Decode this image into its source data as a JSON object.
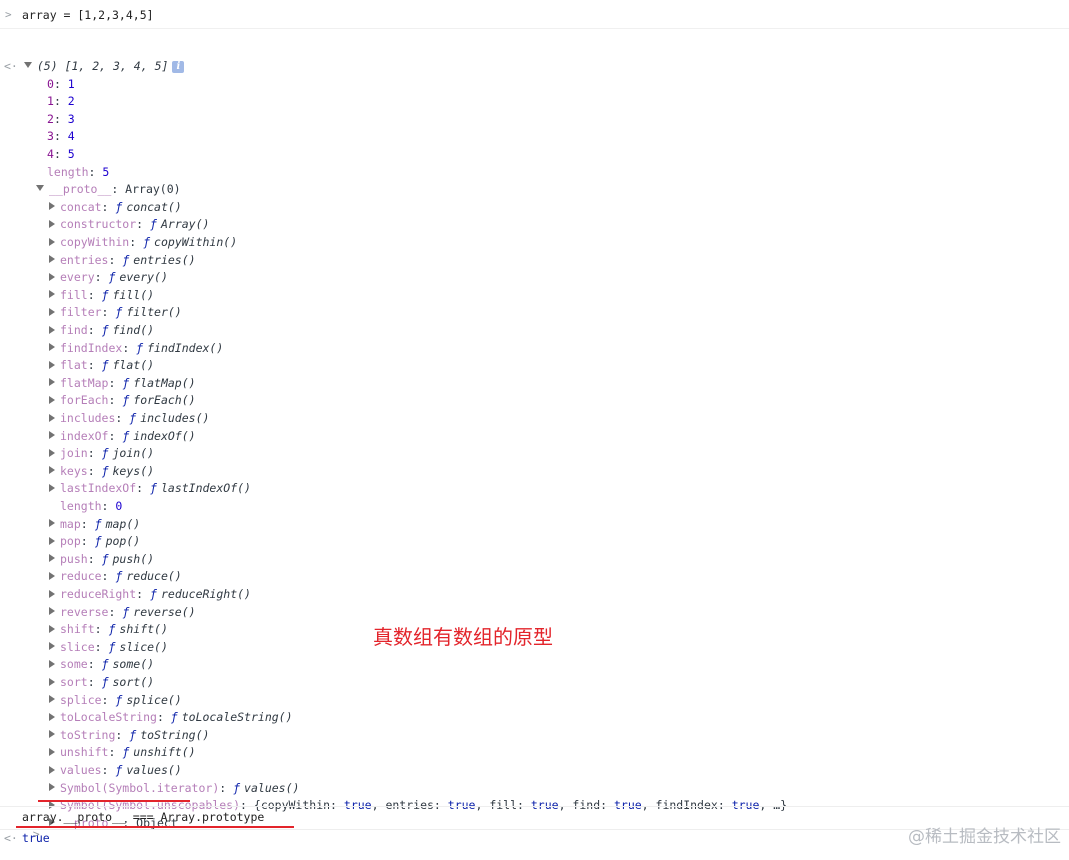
{
  "first_command": {
    "prompt_glyph": ">",
    "text": "array = [1,2,3,4,5]"
  },
  "result": {
    "out_glyph": "<·",
    "summary_count": "(5)",
    "summary_values": "[1, 2, 3, 4, 5]",
    "info_badge": "i",
    "elements": [
      {
        "key": "0",
        "value": "1"
      },
      {
        "key": "1",
        "value": "2"
      },
      {
        "key": "2",
        "value": "3"
      },
      {
        "key": "3",
        "value": "4"
      },
      {
        "key": "4",
        "value": "5"
      }
    ],
    "length_key": "length",
    "length_value": "5",
    "proto_key": "__proto__",
    "proto_value": "Array(0)",
    "proto_methods": [
      {
        "key": "concat",
        "fn": "concat()"
      },
      {
        "key": "constructor",
        "fn": "Array()"
      },
      {
        "key": "copyWithin",
        "fn": "copyWithin()"
      },
      {
        "key": "entries",
        "fn": "entries()"
      },
      {
        "key": "every",
        "fn": "every()"
      },
      {
        "key": "fill",
        "fn": "fill()"
      },
      {
        "key": "filter",
        "fn": "filter()"
      },
      {
        "key": "find",
        "fn": "find()"
      },
      {
        "key": "findIndex",
        "fn": "findIndex()"
      },
      {
        "key": "flat",
        "fn": "flat()"
      },
      {
        "key": "flatMap",
        "fn": "flatMap()"
      },
      {
        "key": "forEach",
        "fn": "forEach()"
      },
      {
        "key": "includes",
        "fn": "includes()"
      },
      {
        "key": "indexOf",
        "fn": "indexOf()"
      },
      {
        "key": "join",
        "fn": "join()"
      },
      {
        "key": "keys",
        "fn": "keys()"
      },
      {
        "key": "lastIndexOf",
        "fn": "lastIndexOf()"
      }
    ],
    "proto_length_key": "length",
    "proto_length_value": "0",
    "proto_methods_2": [
      {
        "key": "map",
        "fn": "map()"
      },
      {
        "key": "pop",
        "fn": "pop()"
      },
      {
        "key": "push",
        "fn": "push()"
      },
      {
        "key": "reduce",
        "fn": "reduce()"
      },
      {
        "key": "reduceRight",
        "fn": "reduceRight()"
      },
      {
        "key": "reverse",
        "fn": "reverse()"
      },
      {
        "key": "shift",
        "fn": "shift()"
      },
      {
        "key": "slice",
        "fn": "slice()"
      },
      {
        "key": "some",
        "fn": "some()"
      },
      {
        "key": "sort",
        "fn": "sort()"
      },
      {
        "key": "splice",
        "fn": "splice()"
      },
      {
        "key": "toLocaleString",
        "fn": "toLocaleString()"
      },
      {
        "key": "toString",
        "fn": "toString()"
      },
      {
        "key": "unshift",
        "fn": "unshift()"
      },
      {
        "key": "values",
        "fn": "values()"
      },
      {
        "key": "Symbol(Symbol.iterator)",
        "fn": "values()"
      }
    ],
    "unscopables_key": "Symbol(Symbol.unscopables)",
    "unscopables_open": "{copyWithin: ",
    "unscopables_parts": [
      {
        "label": "copyWithin: ",
        "val": "true"
      },
      {
        "label": ", entries: ",
        "val": "true"
      },
      {
        "label": ", fill: ",
        "val": "true"
      },
      {
        "label": ", find: ",
        "val": "true"
      },
      {
        "label": ", findIndex: ",
        "val": "true"
      }
    ],
    "unscopables_tail": ", …}",
    "inner_proto_key": "__proto__",
    "inner_proto_value": "Object",
    "f_symbol": "ƒ"
  },
  "annotation": "真数组有数组的原型",
  "second_command": {
    "prompt_glyph": ">",
    "text": "array.__proto__ === Array.prototype"
  },
  "second_result": {
    "out_glyph": "<·",
    "value": "true"
  },
  "watermark": "@稀土掘金技术社区",
  "colors": {
    "annotation": "#e3242b",
    "key_purple": "#881391",
    "number_blue": "#1c00cf",
    "keyword_blue": "#0d22aa"
  }
}
